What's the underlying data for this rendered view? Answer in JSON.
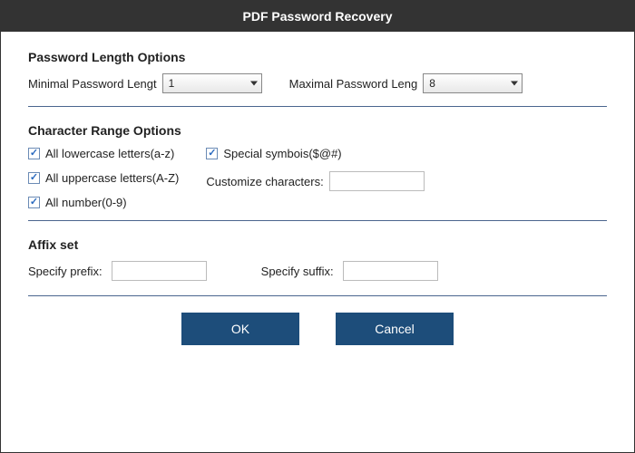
{
  "title": "PDF Password Recovery",
  "lengthSection": {
    "heading": "Password Length Options",
    "minLabel": "Minimal Password Lengt",
    "minValue": "1",
    "maxLabel": "Maximal Password Leng",
    "maxValue": "8"
  },
  "charSection": {
    "heading": "Character Range Options",
    "lowercase": {
      "label": "All lowercase letters(a-z)",
      "checked": true
    },
    "uppercase": {
      "label": "All uppercase letters(A-Z)",
      "checked": true
    },
    "numbers": {
      "label": "All number(0-9)",
      "checked": true
    },
    "special": {
      "label": "Special symbois($@#)",
      "checked": true
    },
    "customizeLabel": "Customize characters:",
    "customizeValue": ""
  },
  "affixSection": {
    "heading": "Affix set",
    "prefixLabel": "Specify prefix:",
    "prefixValue": "",
    "suffixLabel": "Specify suffix:",
    "suffixValue": ""
  },
  "buttons": {
    "ok": "OK",
    "cancel": "Cancel"
  }
}
